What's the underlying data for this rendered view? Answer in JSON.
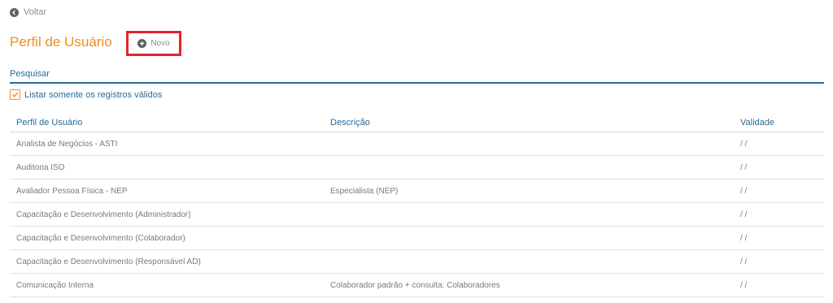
{
  "back": {
    "label": "Voltar",
    "icon": "arrow-left-circle-icon"
  },
  "header": {
    "title": "Perfil de Usuário",
    "new_label": "Novo",
    "new_icon": "plus-circle-icon"
  },
  "search": {
    "placeholder": "Pesquisar",
    "value": ""
  },
  "filter": {
    "label": "Listar somente os registros válidos",
    "checked": true
  },
  "table": {
    "columns": [
      "Perfil de Usuário",
      "Descrição",
      "Validade"
    ],
    "rows": [
      [
        "Analista de Negócios - ASTI",
        "",
        "/ /"
      ],
      [
        "Auditoria ISO",
        "",
        "/ /"
      ],
      [
        "Avaliador Pessoa Física - NEP",
        "Especialista (NEP)",
        "/ /"
      ],
      [
        "Capacitação e Desenvolvimento (Administrador)",
        "",
        "/ /"
      ],
      [
        "Capacitação e Desenvolvimento (Colaborador)",
        "",
        "/ /"
      ],
      [
        "Capacitação e Desenvolvimento (Responsável AD)",
        "",
        "/ /"
      ],
      [
        "Comunicação Interna",
        "Colaborador padrão + consulta: Colaboradores",
        "/ /"
      ]
    ]
  },
  "colors": {
    "accent": "#f28c28",
    "link": "#2a6a98",
    "highlight": "#e3232f"
  }
}
